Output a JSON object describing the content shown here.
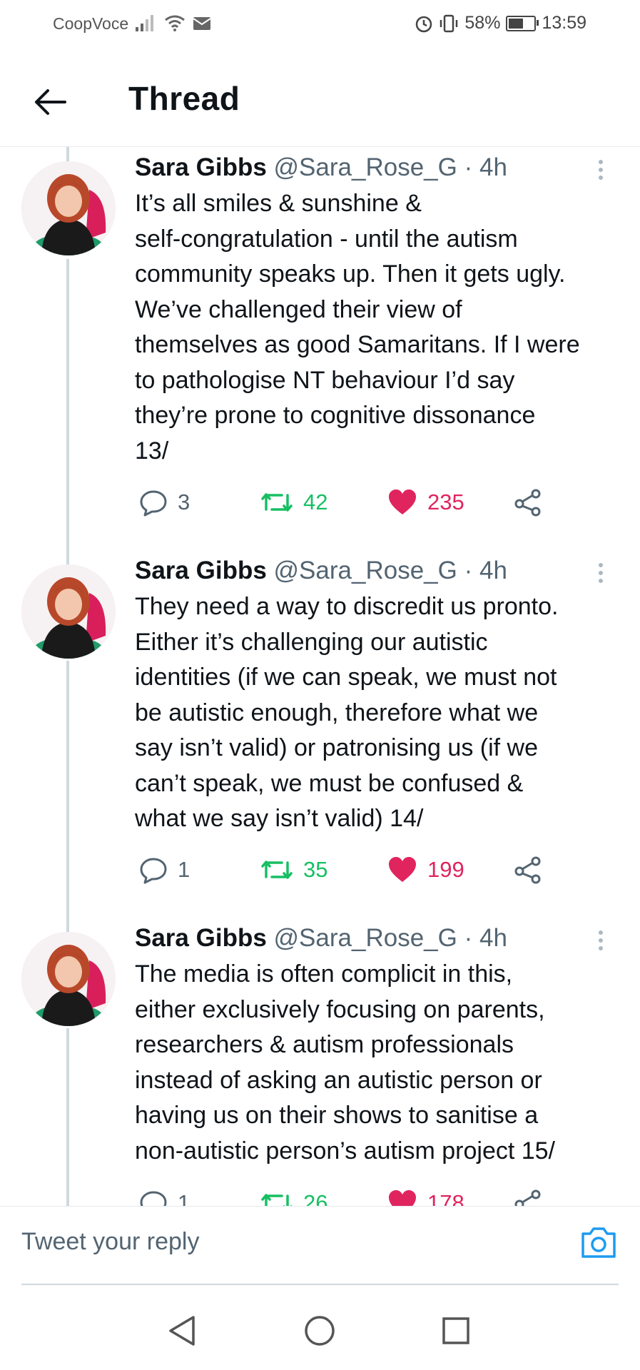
{
  "status_bar": {
    "carrier": "CoopVoce",
    "battery": "58%",
    "battery_level": 0.58,
    "time": "13:59"
  },
  "header": {
    "title": "Thread"
  },
  "tweets": [
    {
      "name": "Sara Gibbs",
      "handle": "@Sara_Rose_G",
      "dot": "·",
      "time": "4h",
      "text": "It’s all smiles & sunshine &\nself-congratulation - until the autism\ncommunity speaks up. Then it gets ugly.\nWe’ve challenged their view of\nthemselves as good Samaritans. If I were\nto pathologise NT behaviour I’d say\nthey’re prone to cognitive dissonance\n13/",
      "replies": "3",
      "retweets": "42",
      "likes": "235"
    },
    {
      "name": "Sara Gibbs",
      "handle": "@Sara_Rose_G",
      "dot": "·",
      "time": "4h",
      "text": "They need a way to discredit us pronto.\nEither it’s challenging our autistic\nidentities (if we can speak, we must not\nbe autistic enough, therefore what we\nsay isn’t valid) or patronising us (if we\ncan’t speak, we must be confused &\nwhat we say isn’t valid) 14/",
      "replies": "1",
      "retweets": "35",
      "likes": "199"
    },
    {
      "name": "Sara Gibbs",
      "handle": "@Sara_Rose_G",
      "dot": "·",
      "time": "4h",
      "text": "The media is often complicit in this,\neither exclusively focusing on parents,\nresearchers & autism professionals\ninstead of asking an autistic person or\nhaving us on their shows to sanitise a\nnon-autistic person’s autism project 15/",
      "replies": "1",
      "retweets": "26",
      "likes": "178"
    }
  ],
  "reply_bar": {
    "placeholder": "Tweet your reply"
  },
  "colors": {
    "retweet": "#17bf63",
    "like": "#e0245e",
    "accent": "#1d9bf0"
  }
}
